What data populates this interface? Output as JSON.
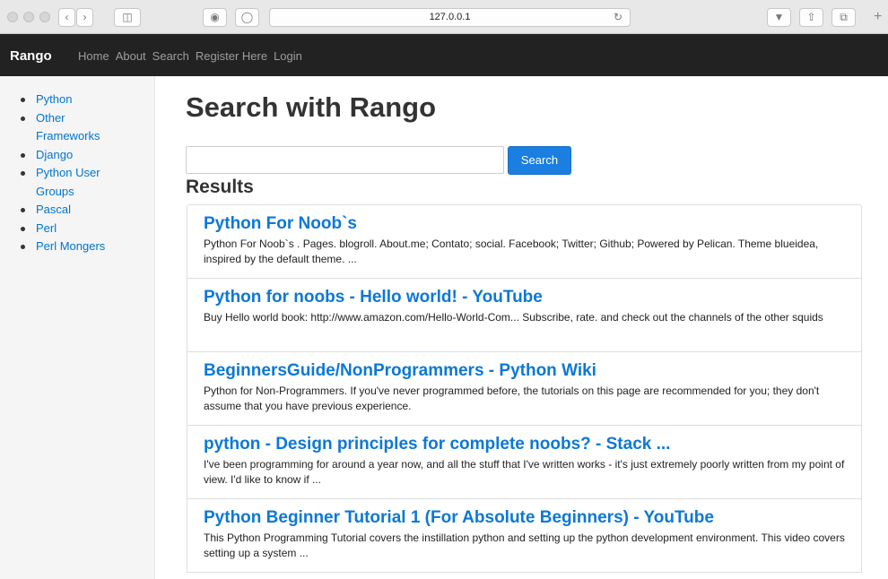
{
  "browser": {
    "url": "127.0.0.1"
  },
  "navbar": {
    "brand": "Rango",
    "links": [
      "Home",
      "About",
      "Search",
      "Register Here",
      "Login"
    ]
  },
  "sidebar": {
    "items": [
      "Python",
      "Other Frameworks",
      "Django",
      "Python User Groups",
      "Pascal",
      "Perl",
      "Perl Mongers"
    ]
  },
  "main": {
    "title": "Search with Rango",
    "search_value": "",
    "search_button": "Search",
    "results_heading": "Results",
    "results": [
      {
        "title": "Python For Noob`s",
        "summary": "Python For Noob`s . Pages. blogroll. About.me; Contato; social. Facebook; Twitter; Github; Powered by Pelican. Theme blueidea, inspired by the default theme. ..."
      },
      {
        "title": "Python for noobs - Hello world! - YouTube",
        "summary": "Buy Hello world book: http://www.amazon.com/Hello-World-Com... Subscribe, rate. and check out the channels of the other squids"
      },
      {
        "title": "BeginnersGuide/NonProgrammers - Python Wiki",
        "summary": "Python for Non-Programmers. If you've never programmed before, the tutorials on this page are recommended for you; they don't assume that you have previous experience."
      },
      {
        "title": "python - Design principles for complete noobs? - Stack ...",
        "summary": "I've been programming for around a year now, and all the stuff that I've written works - it's just extremely poorly written from my point of view. I'd like to know if ..."
      },
      {
        "title": "Python Beginner Tutorial 1 (For Absolute Beginners) - YouTube",
        "summary": "This Python Programming Tutorial covers the instillation python and setting up the python development environment. This video covers setting up a system ..."
      }
    ]
  },
  "colors": {
    "navbar_bg": "#222222",
    "link": "#0075d0",
    "button": "#1a7fe0"
  }
}
